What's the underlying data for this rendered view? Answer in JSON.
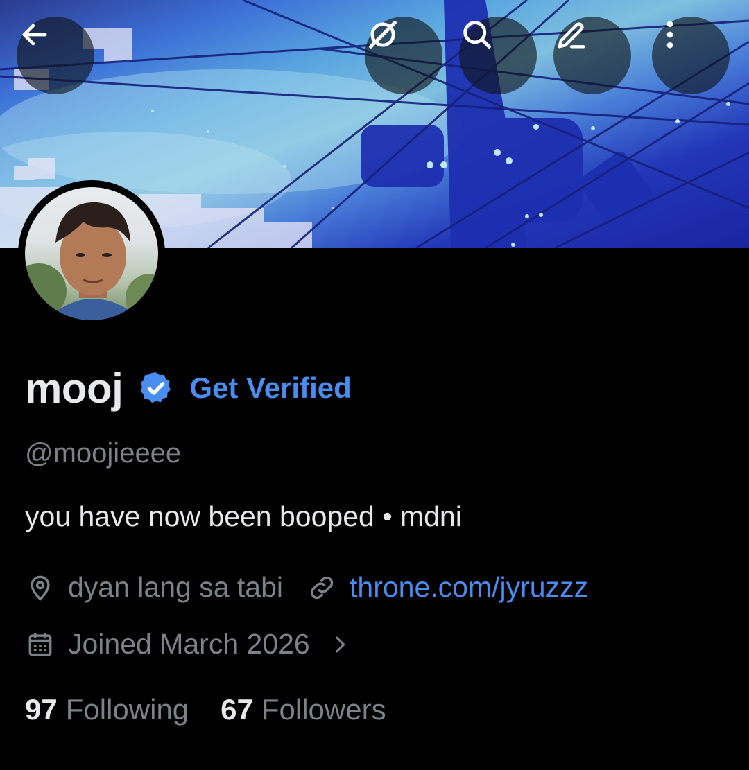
{
  "topbar": {
    "back_icon": "arrow-left-icon",
    "grok_icon": "slashed-circle-icon",
    "search_icon": "search-icon",
    "edit_icon": "pencil-icon",
    "more_icon": "vertical-dots-icon"
  },
  "profile": {
    "display_name": "mooj",
    "get_verified_label": "Get Verified",
    "handle": "@moojieeee",
    "bio": "you have now been booped • mdni",
    "location": "dyan lang sa tabi",
    "website": "throne.com/jyruzzz",
    "joined": "Joined March 2026"
  },
  "stats": {
    "following_count": "97",
    "following_label": "Following",
    "followers_count": "67",
    "followers_label": "Followers"
  },
  "colors": {
    "background": "#000000",
    "accent": "#4a8df0",
    "muted": "#7c8289",
    "text": "#e7e9ea"
  }
}
